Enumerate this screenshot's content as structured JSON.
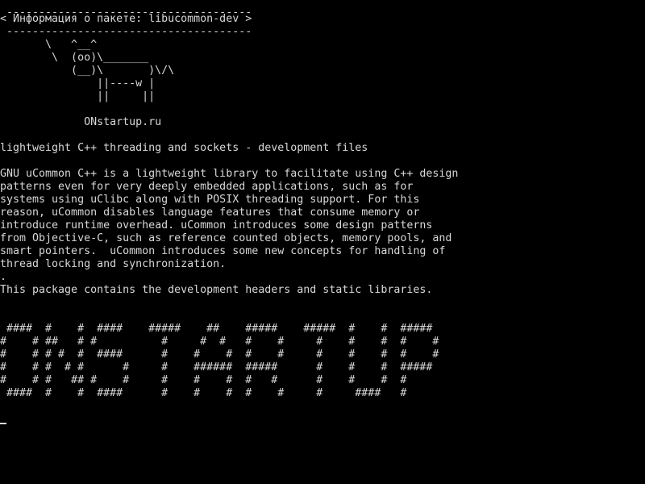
{
  "terminal": {
    "background": "#000000",
    "foreground": "#d8d8d8",
    "lines": [
      " --------------------------------------",
      "< Информация о пакете: libucommon-dev >",
      " --------------------------------------",
      "       \\   ^__^",
      "        \\  (oo)\\_______",
      "           (__)\\       )\\/\\",
      "               ||----w |",
      "               ||     ||",
      "",
      "             ONstartup.ru",
      "",
      "lightweight C++ threading and sockets - development files",
      "",
      "GNU uCommon C++ is a lightweight library to facilitate using C++ design",
      "patterns even for very deeply embedded applications, such as for",
      "systems using uClibc along with POSIX threading support. For this",
      "reason, uCommon disables language features that consume memory or",
      "introduce runtime overhead. uCommon introduces some design patterns",
      "from Objective-C, such as reference counted objects, memory pools, and",
      "smart pointers.  uCommon introduces some new concepts for handling of",
      "thread locking and synchronization.",
      ".",
      "This package contains the development headers and static libraries.",
      "",
      "",
      " ####  #    #  ####    #####    ##    #####    #####  #    #  #####",
      "#    # ##   # #          #     #  #   #    #     #    #    #  #    #",
      "#    # # #  #  ####      #    #    #  #    #     #    #    #  #    #",
      "#    # #  # #      #     #    ######  #####      #    #    #  #####",
      "#    # #   ## #    #     #    #    #  #   #      #    #    #  #",
      " ####  #    #  ####      #    #    #  #    #     #     ####   #"
    ]
  }
}
